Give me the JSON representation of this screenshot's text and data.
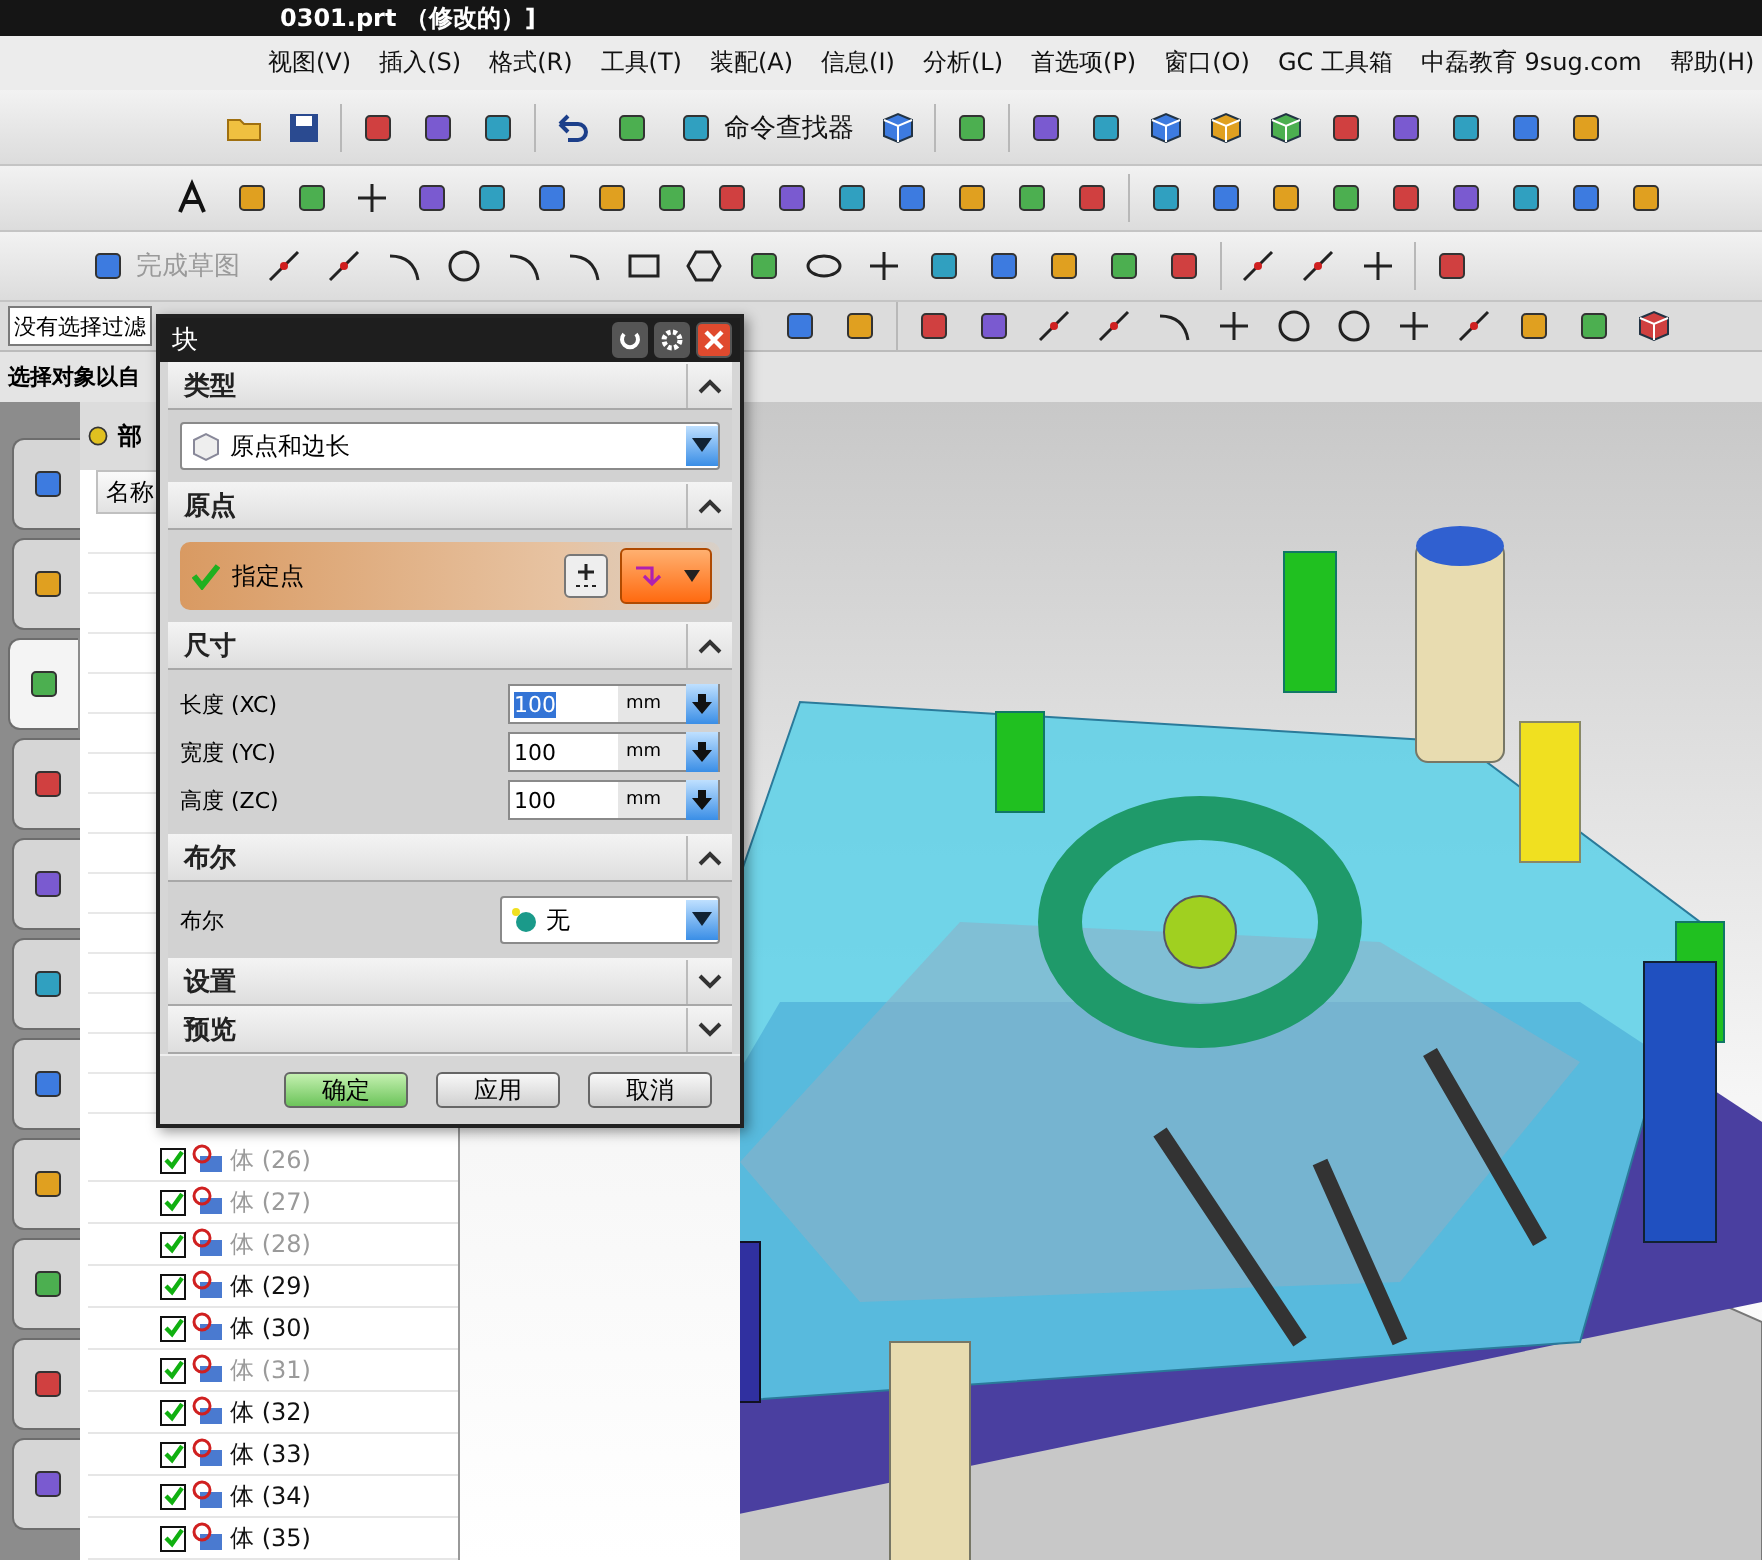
{
  "window": {
    "title": "0301.prt （修改的）]"
  },
  "menu": [
    "视图(V)",
    "插入(S)",
    "格式(R)",
    "工具(T)",
    "装配(A)",
    "信息(I)",
    "分析(L)",
    "首选项(P)",
    "窗口(O)",
    "GC 工具箱",
    "中磊教育 9sug.com",
    "帮助(H)"
  ],
  "toolbar": {
    "command_finder": "命令查找器",
    "finish_sketch": {
      "label": "完成草图",
      "disabled": true
    }
  },
  "selection_bar": {
    "filter": "没有选择过滤"
  },
  "hint": "选择对象以自",
  "resource_tabs": [
    {
      "selected": false
    },
    {
      "selected": false
    },
    {
      "selected": true
    },
    {
      "selected": false
    },
    {
      "selected": false
    },
    {
      "selected": false
    },
    {
      "selected": false
    },
    {
      "selected": false
    },
    {
      "selected": false
    },
    {
      "selected": false
    },
    {
      "selected": false
    }
  ],
  "navigator": {
    "title": "部",
    "column": "名称",
    "rows": [
      {
        "label": "体 (26)",
        "checked": true,
        "dimmed": true
      },
      {
        "label": "体 (27)",
        "checked": true,
        "dimmed": true
      },
      {
        "label": "体 (28)",
        "checked": true,
        "dimmed": true
      },
      {
        "label": "体 (29)",
        "checked": true,
        "dimmed": false
      },
      {
        "label": "体 (30)",
        "checked": true,
        "dimmed": false
      },
      {
        "label": "体 (31)",
        "checked": true,
        "dimmed": true
      },
      {
        "label": "体 (32)",
        "checked": true,
        "dimmed": false
      },
      {
        "label": "体 (33)",
        "checked": true,
        "dimmed": false
      },
      {
        "label": "体 (34)",
        "checked": true,
        "dimmed": false
      },
      {
        "label": "体 (35)",
        "checked": true,
        "dimmed": false
      }
    ]
  },
  "dialog": {
    "title": "块",
    "sections": [
      {
        "kind": "type",
        "title": "类型",
        "expanded": true,
        "value": "原点和边长"
      },
      {
        "kind": "point",
        "title": "原点",
        "expanded": true,
        "label": "指定点",
        "done": true
      },
      {
        "kind": "dimensions",
        "title": "尺寸",
        "expanded": true,
        "fields": [
          {
            "label": "长度 (XC)",
            "value": "100",
            "unit": "mm",
            "selected": true
          },
          {
            "label": "宽度 (YC)",
            "value": "100",
            "unit": "mm",
            "selected": false
          },
          {
            "label": "高度 (ZC)",
            "value": "100",
            "unit": "mm",
            "selected": false
          }
        ]
      },
      {
        "kind": "boolean",
        "title": "布尔",
        "expanded": true,
        "label": "布尔",
        "value": "无"
      },
      {
        "title": "设置",
        "expanded": false
      },
      {
        "title": "预览",
        "expanded": false
      }
    ],
    "buttons": [
      {
        "label": "确定",
        "default": true
      },
      {
        "label": "应用",
        "default": false
      },
      {
        "label": "取消",
        "default": false
      }
    ]
  }
}
